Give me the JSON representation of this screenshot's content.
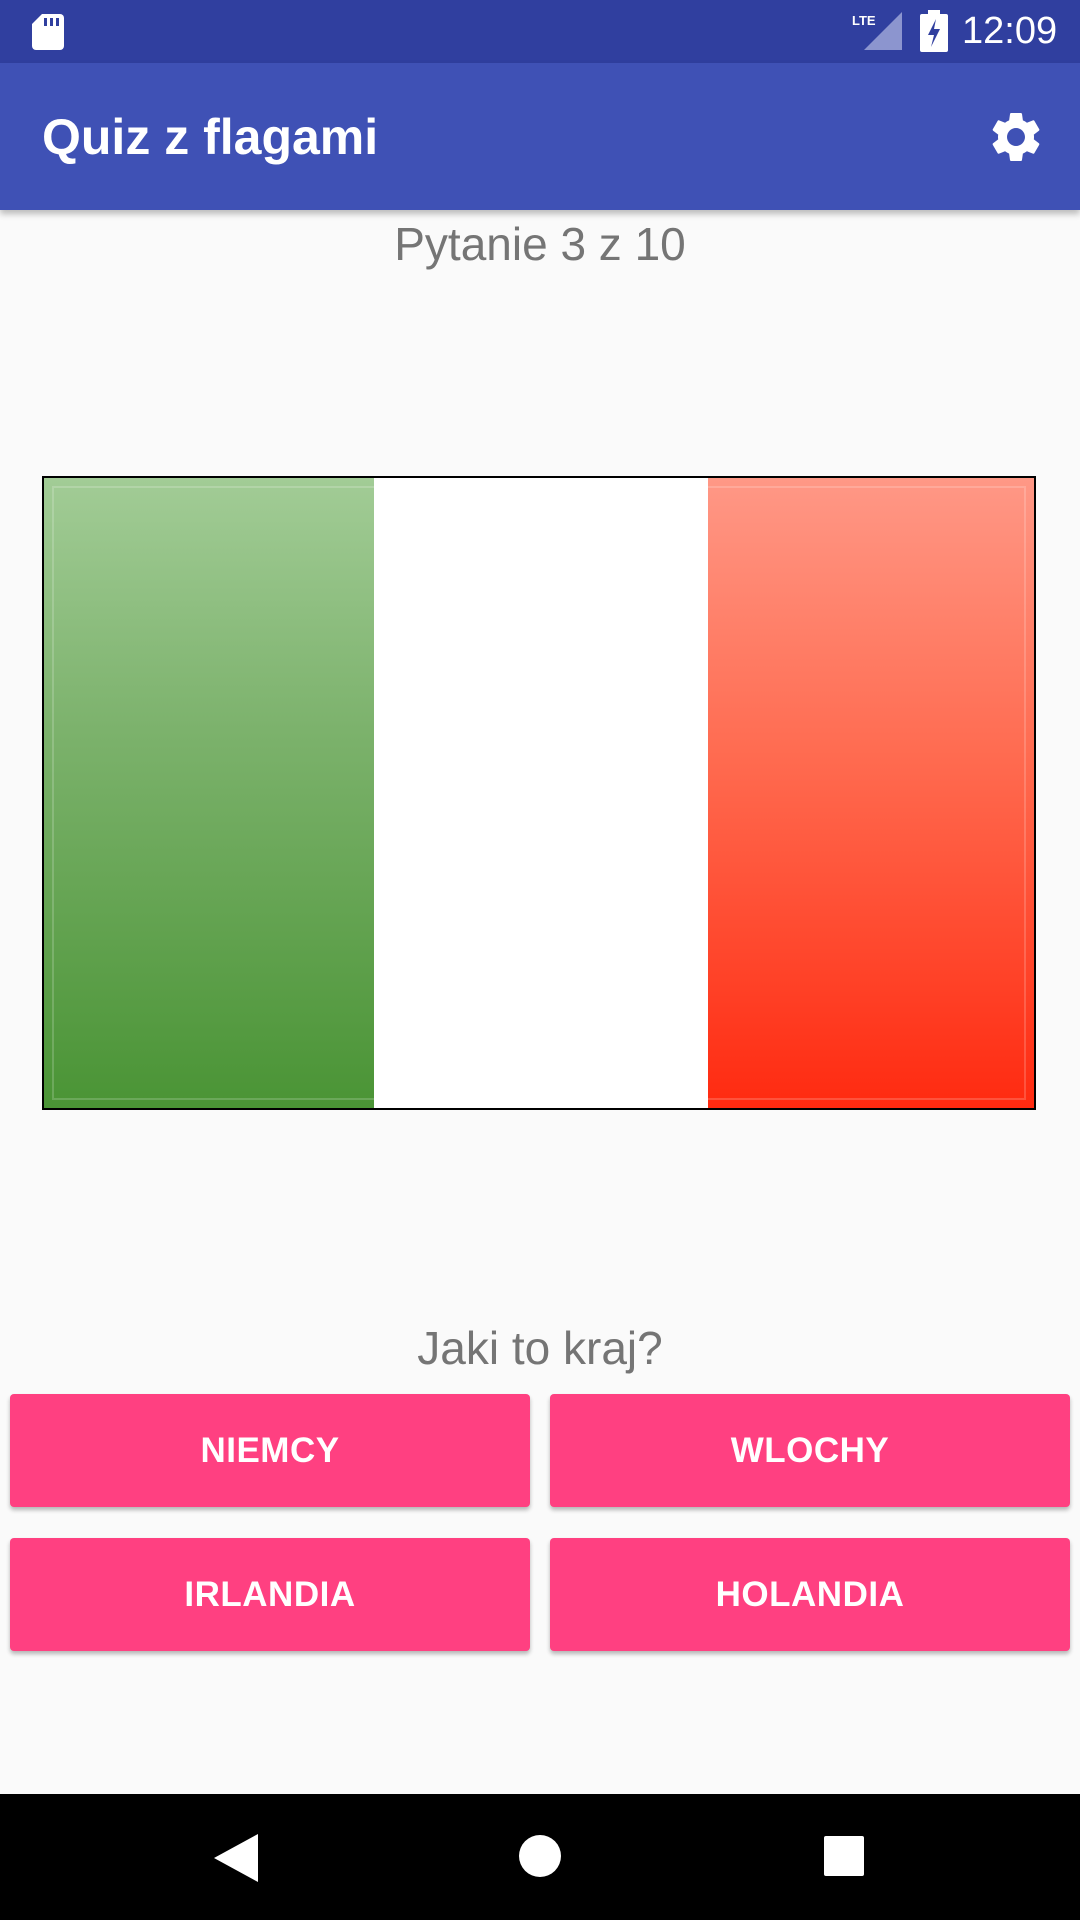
{
  "status_bar": {
    "time": "12:09",
    "network_label": "LTE",
    "icons": [
      "sd-card-icon",
      "signal-icon",
      "battery-charging-icon"
    ]
  },
  "app_bar": {
    "title": "Quiz z flagami",
    "settings_icon": "gear-icon"
  },
  "quiz": {
    "counter": "Pytanie 3 z 10",
    "prompt": "Jaki to kraj?",
    "flag_colors": {
      "left": "#4a9435",
      "middle": "#ffffff",
      "right": "#ff2a10"
    },
    "answers": [
      {
        "label": "NIEMCY"
      },
      {
        "label": "WLOCHY"
      },
      {
        "label": "IRLANDIA"
      },
      {
        "label": "HOLANDIA"
      }
    ]
  },
  "colors": {
    "status_bar": "#303f9f",
    "app_bar": "#3f51b5",
    "accent": "#ff4081",
    "background": "#fafafa",
    "secondary_text": "#757575"
  },
  "nav_bar": {
    "icons": [
      "back-icon",
      "home-icon",
      "recents-icon"
    ]
  }
}
